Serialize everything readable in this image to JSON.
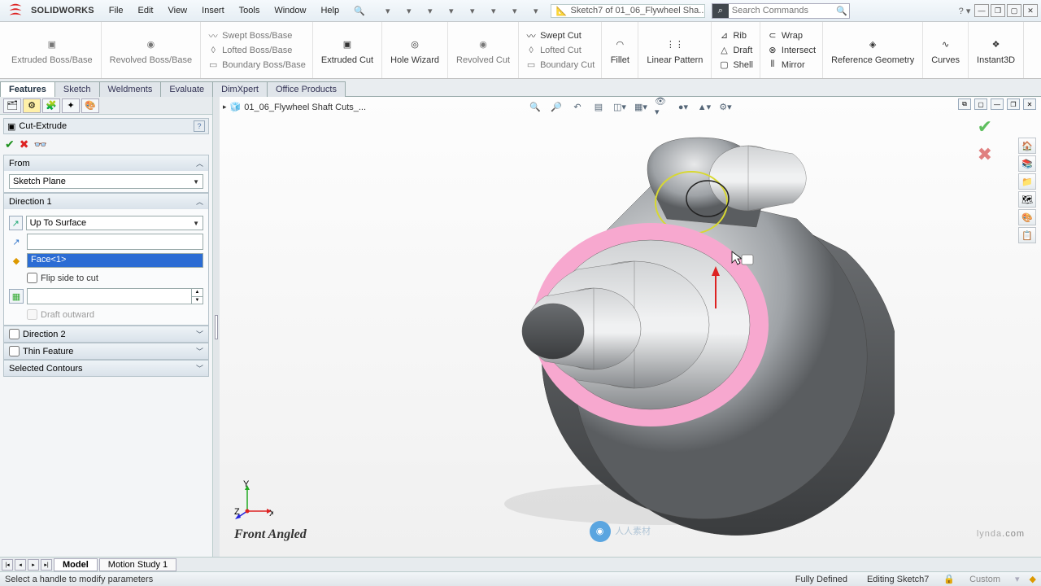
{
  "app": {
    "title": "SOLIDWORKS"
  },
  "menu": [
    "File",
    "Edit",
    "View",
    "Insert",
    "Tools",
    "Window",
    "Help"
  ],
  "context_tab": "Sketch7 of 01_06_Flywheel Sha...",
  "search": {
    "placeholder": "Search Commands"
  },
  "ribbon": {
    "features": {
      "extruded_boss": "Extruded Boss/Base",
      "revolved_boss": "Revolved Boss/Base",
      "swept_boss": "Swept Boss/Base",
      "lofted_boss": "Lofted Boss/Base",
      "boundary_boss": "Boundary Boss/Base",
      "extruded_cut": "Extruded Cut",
      "hole_wizard": "Hole Wizard",
      "revolved_cut": "Revolved Cut",
      "swept_cut": "Swept Cut",
      "lofted_cut": "Lofted Cut",
      "boundary_cut": "Boundary Cut",
      "fillet": "Fillet",
      "linear_pattern": "Linear Pattern",
      "rib": "Rib",
      "draft": "Draft",
      "shell": "Shell",
      "wrap": "Wrap",
      "intersect": "Intersect",
      "mirror": "Mirror",
      "ref_geom": "Reference Geometry",
      "curves": "Curves",
      "instant3d": "Instant3D"
    }
  },
  "cmdtabs": [
    "Features",
    "Sketch",
    "Weldments",
    "Evaluate",
    "DimXpert",
    "Office Products"
  ],
  "feature": {
    "name": "Cut-Extrude",
    "from": {
      "label": "From",
      "value": "Sketch Plane"
    },
    "dir1": {
      "label": "Direction 1",
      "end_condition": "Up To Surface",
      "face_value": "Face<1>",
      "flip": "Flip side to cut",
      "draft_outward": "Draft outward"
    },
    "dir2": {
      "label": "Direction 2"
    },
    "thin": {
      "label": "Thin Feature"
    },
    "selcon": {
      "label": "Selected Contours"
    }
  },
  "doc": {
    "name": "01_06_Flywheel Shaft Cuts_..."
  },
  "view": {
    "label": "Front Angled"
  },
  "btabs": [
    "Model",
    "Motion Study 1"
  ],
  "status": {
    "msg": "Select a handle to modify parameters",
    "defined": "Fully Defined",
    "editing": "Editing Sketch7",
    "custom": "Custom"
  },
  "watermark": {
    "site": "人人素材",
    "brand_a": "lynda",
    "brand_b": ".com"
  }
}
